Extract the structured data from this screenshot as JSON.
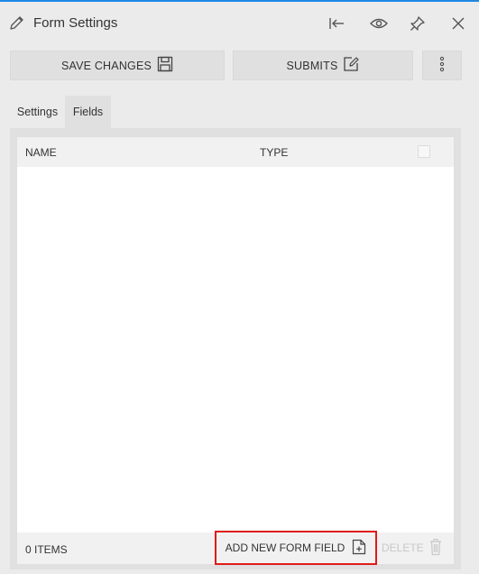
{
  "header": {
    "title": "Form Settings",
    "icons": [
      "pencil-icon",
      "collapse-left-icon",
      "eye-icon",
      "pin-icon",
      "close-icon"
    ]
  },
  "toolbar": {
    "save_label": "SAVE CHANGES",
    "submits_label": "SUBMITS",
    "more_icon": "vertical-dots-icon"
  },
  "tabs": [
    {
      "label": "Settings",
      "active": false
    },
    {
      "label": "Fields",
      "active": true
    }
  ],
  "grid": {
    "columns": [
      "NAME",
      "TYPE"
    ],
    "rows": [],
    "footer": {
      "items_count": "0 ITEMS",
      "add_label": "ADD NEW FORM FIELD",
      "delete_label": "DELETE"
    }
  },
  "colors": {
    "accent_top_border": "#1e88e5",
    "highlight_border": "#e01b1b"
  }
}
